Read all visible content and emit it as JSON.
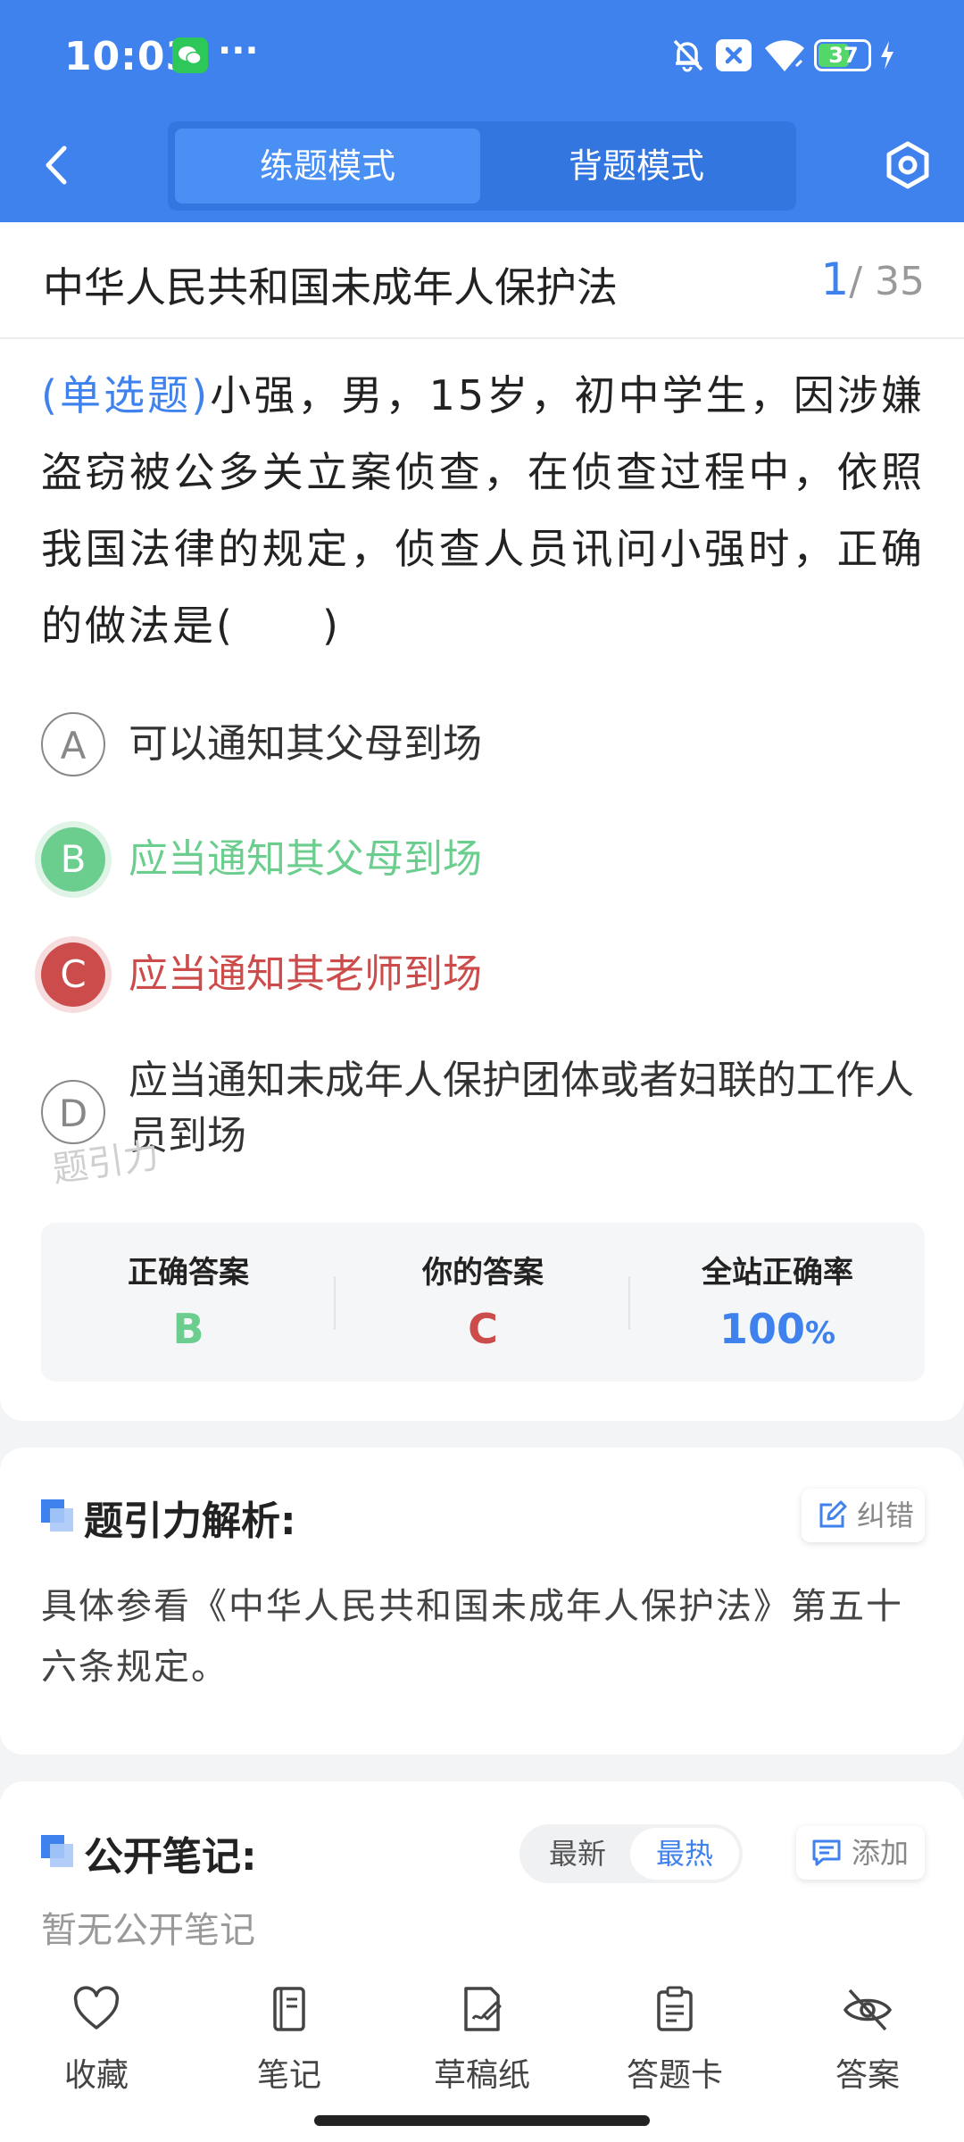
{
  "status_bar": {
    "time": "10:03",
    "more": "···",
    "battery": "37"
  },
  "nav": {
    "mode_practice": "练题模式",
    "mode_memorize": "背题模式"
  },
  "question": {
    "law_title": "中华人民共和国未成年人保护法",
    "current": "1",
    "total": "/ 35",
    "type_tag": "(单选题)",
    "text": "小强，男，15岁，初中学生，因涉嫌盗窃被公多关立案侦查，在侦查过程中，依照我国法律的规定，侦查人员讯问小强时，正确的做法是(　　)",
    "options": [
      {
        "letter": "A",
        "text": "可以通知其父母到场",
        "state": "plain"
      },
      {
        "letter": "B",
        "text": "应当通知其父母到场",
        "state": "correct"
      },
      {
        "letter": "C",
        "text": "应当通知其老师到场",
        "state": "wrong"
      },
      {
        "letter": "D",
        "text": "应当通知未成年人保护团体或者妇联的工作人员到场",
        "state": "plain"
      }
    ],
    "watermark": "题引力"
  },
  "stats": {
    "correct_label": "正确答案",
    "correct_value": "B",
    "yours_label": "你的答案",
    "yours_value": "C",
    "rate_label": "全站正确率",
    "rate_value": "100",
    "rate_unit": "%"
  },
  "analysis": {
    "title": "题引力解析:",
    "report_label": "纠错",
    "text": "具体参看《中华人民共和国未成年人保护法》第五十六条规定。"
  },
  "notes": {
    "title": "公开笔记:",
    "sort_latest": "最新",
    "sort_hot": "最热",
    "add_label": "添加",
    "empty": "暂无公开笔记"
  },
  "tabbar": {
    "favorite": "收藏",
    "notes": "笔记",
    "draft": "草稿纸",
    "answer_sheet": "答题卡",
    "answer": "答案"
  },
  "colors": {
    "primary": "#3f82ee",
    "correct": "#6cce8e",
    "wrong": "#cc4b4b"
  }
}
